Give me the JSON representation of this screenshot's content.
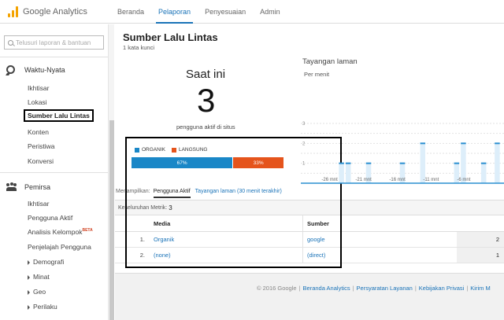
{
  "app": {
    "logo_text": "Google Analytics"
  },
  "topnav": {
    "items": [
      {
        "label": "Beranda"
      },
      {
        "label": "Pelaporan"
      },
      {
        "label": "Penyesuaian"
      },
      {
        "label": "Admin"
      }
    ],
    "active": "Pelaporan"
  },
  "sidebar": {
    "search_placeholder": "Telusuri laporan & bantuan",
    "realtime": {
      "title": "Waktu-Nyata",
      "items": [
        "Ikhtisar",
        "Lokasi",
        "Sumber Lalu Lintas",
        "Konten",
        "Peristiwa",
        "Konversi"
      ],
      "selected": "Sumber Lalu Lintas"
    },
    "audience": {
      "title": "Pemirsa",
      "items": [
        "Ikhtisar",
        "Pengguna Aktif",
        "Analisis Kelompok",
        "Penjelajah Pengguna",
        "Demografi",
        "Minat",
        "Geo",
        "Perilaku"
      ],
      "beta_badge": "BETA"
    }
  },
  "main": {
    "title": "Sumber Lalu Lintas",
    "subtitle": "1 kata kunci",
    "now_label": "Saat ini",
    "active_users": "3",
    "active_users_caption": "pengguna aktif di situs",
    "legend": [
      {
        "label": "ORGANIK",
        "color": "#1a87c7"
      },
      {
        "label": "LANGSUNG",
        "color": "#e5541c"
      }
    ],
    "split": {
      "organic_label": "67%",
      "direct_label": "33%",
      "organic_fraction": 0.67,
      "direct_fraction": 0.33
    },
    "display": {
      "label": "Menampilkan:",
      "active_option": "Pengguna Aktif",
      "other_option": "Tayangan laman (30 menit terakhir)"
    },
    "table": {
      "summary_label": "Keseluruhan Metrik:",
      "summary_value": "3",
      "headers": {
        "media": "Media",
        "source": "Sumber"
      },
      "rows": [
        {
          "idx": "1.",
          "media": "Organik",
          "source": "google",
          "value": "2"
        },
        {
          "idx": "2.",
          "media": "(none)",
          "source": "(direct)",
          "value": "1"
        }
      ]
    }
  },
  "chart_data": {
    "type": "bar",
    "title": "Tayangan laman",
    "subtitle": "Per menit",
    "y_ticks": [
      "3",
      "2",
      "1"
    ],
    "x_labels": [
      "-26 mnt",
      "-21 mnt",
      "-16 mnt",
      "-11 mnt",
      "-6 mnt"
    ],
    "ylim": [
      0,
      3
    ],
    "bar_color": "#ddeefa",
    "bars": [
      {
        "x": -24,
        "y": 1
      },
      {
        "x": -23,
        "y": 1
      },
      {
        "x": -20,
        "y": 1
      },
      {
        "x": -15,
        "y": 1
      },
      {
        "x": -12,
        "y": 2
      },
      {
        "x": -7,
        "y": 1
      },
      {
        "x": -6,
        "y": 2
      },
      {
        "x": -3,
        "y": 1
      },
      {
        "x": -1,
        "y": 2
      }
    ]
  },
  "footer": {
    "copyright": "© 2016 Google",
    "links": [
      "Beranda Analytics",
      "Persyaratan Layanan",
      "Kebijakan Privasi",
      "Kirim M"
    ]
  }
}
